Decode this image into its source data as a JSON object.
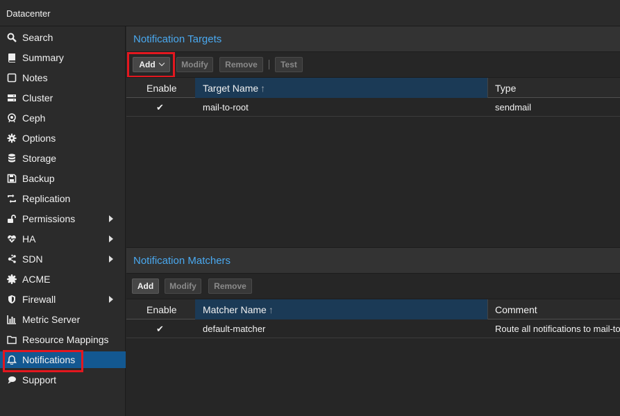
{
  "app": {
    "title": "Datacenter"
  },
  "sidebar": {
    "items": [
      {
        "label": "Search",
        "icon": "search-icon"
      },
      {
        "label": "Summary",
        "icon": "book-icon"
      },
      {
        "label": "Notes",
        "icon": "note-icon"
      },
      {
        "label": "Cluster",
        "icon": "server-icon"
      },
      {
        "label": "Ceph",
        "icon": "ceph-icon"
      },
      {
        "label": "Options",
        "icon": "gear-icon"
      },
      {
        "label": "Storage",
        "icon": "database-icon"
      },
      {
        "label": "Backup",
        "icon": "floppy-icon"
      },
      {
        "label": "Replication",
        "icon": "retweet-icon"
      },
      {
        "label": "Permissions",
        "icon": "unlock-icon"
      },
      {
        "label": "HA",
        "icon": "heartbeat-icon"
      },
      {
        "label": "SDN",
        "icon": "sdn-icon"
      },
      {
        "label": "ACME",
        "icon": "certificate-icon"
      },
      {
        "label": "Firewall",
        "icon": "shield-icon"
      },
      {
        "label": "Metric Server",
        "icon": "bar-chart-icon"
      },
      {
        "label": "Resource Mappings",
        "icon": "folder-icon"
      },
      {
        "label": "Notifications",
        "icon": "bell-icon"
      },
      {
        "label": "Support",
        "icon": "support-icon"
      }
    ],
    "selected": "Notifications",
    "selected_color": "#135891"
  },
  "targets": {
    "title": "Notification Targets",
    "toolbar": {
      "add": "Add",
      "modify": "Modify",
      "remove": "Remove",
      "test": "Test"
    },
    "columns": {
      "enable": "Enable",
      "name": "Target Name",
      "type": "Type"
    },
    "rows": [
      {
        "enable": "✔",
        "name": "mail-to-root",
        "type": "sendmail"
      }
    ]
  },
  "matchers": {
    "title": "Notification Matchers",
    "toolbar": {
      "add": "Add",
      "modify": "Modify",
      "remove": "Remove"
    },
    "columns": {
      "enable": "Enable",
      "name": "Matcher Name",
      "comment": "Comment"
    },
    "rows": [
      {
        "enable": "✔",
        "name": "default-matcher",
        "comment": "Route all notifications to mail-to"
      }
    ]
  },
  "colors": {
    "accent": "#4aa9f0",
    "highlight": "#e3171f"
  }
}
